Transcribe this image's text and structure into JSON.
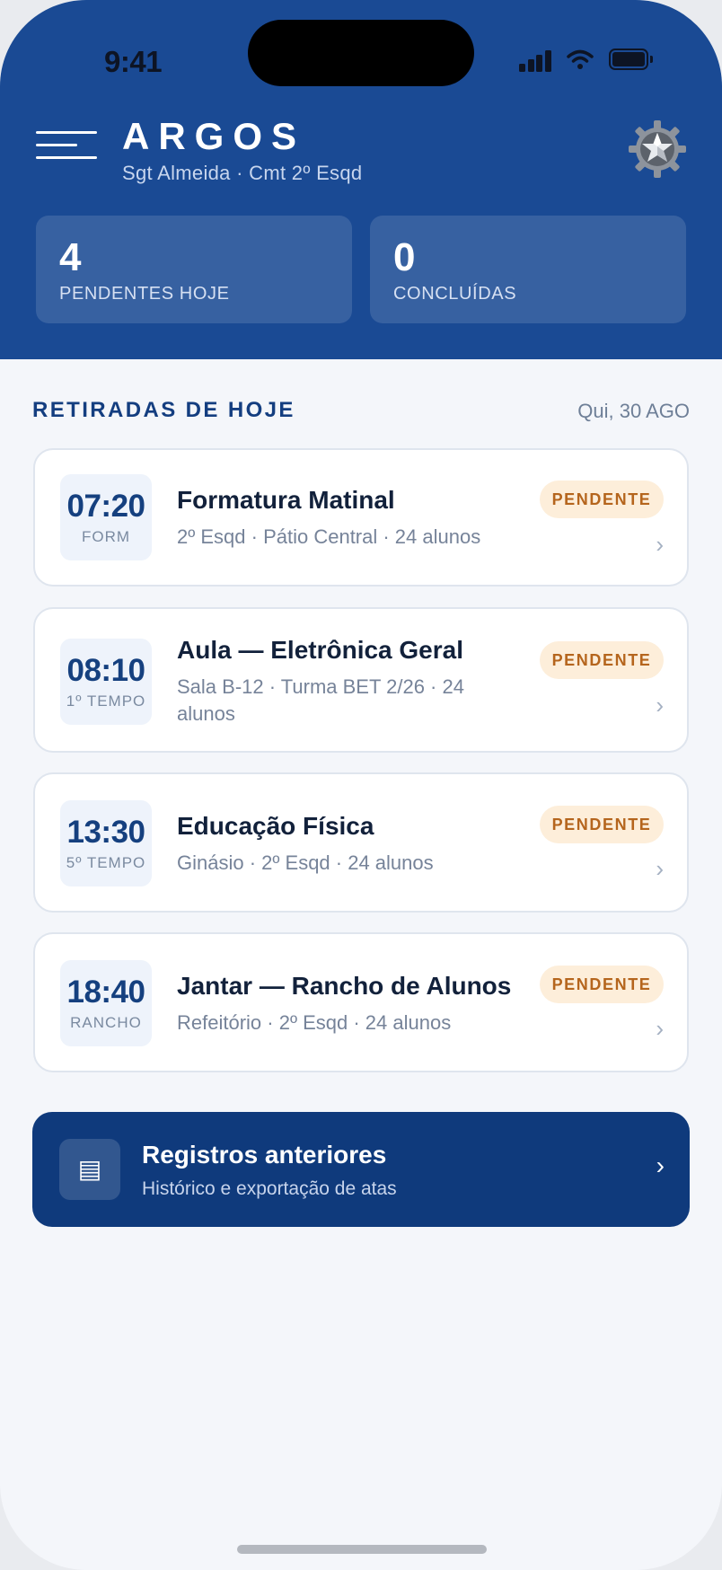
{
  "status_bar": {
    "time": "9:41"
  },
  "header": {
    "title": "ARGOS",
    "subtitle": "Sgt Almeida · Cmt 2º Esqd",
    "menu_icon": "hamburger-icon",
    "settings_icon": "gear-star-icon"
  },
  "stats": [
    {
      "value": "4",
      "label": "PENDENTES HOJE"
    },
    {
      "value": "0",
      "label": "CONCLUÍDAS"
    }
  ],
  "section": {
    "title": "RETIRADAS DE HOJE",
    "date": "Qui, 30 AGO"
  },
  "items": [
    {
      "time": "07:20",
      "period": "FORM",
      "title": "Formatura Matinal",
      "meta": "2º Esqd · Pátio Central · 24 alunos",
      "status": "PENDENTE"
    },
    {
      "time": "08:10",
      "period": "1º TEMPO",
      "title": "Aula — Eletrônica Geral",
      "meta": "Sala B-12 · Turma BET 2/26 · 24 alunos",
      "status": "PENDENTE"
    },
    {
      "time": "13:30",
      "period": "5º TEMPO",
      "title": "Educação Física",
      "meta": "Ginásio · 2º Esqd · 24 alunos",
      "status": "PENDENTE"
    },
    {
      "time": "18:40",
      "period": "RANCHO",
      "title": "Jantar — Rancho de Alunos",
      "meta": "Refeitório · 2º Esqd · 24 alunos",
      "status": "PENDENTE"
    }
  ],
  "history": {
    "icon": "document-list-icon",
    "title": "Registros anteriores",
    "subtitle": "Histórico e exportação de atas"
  },
  "colors": {
    "header": "#1a4a94",
    "accent": "#0f3a7c",
    "badge_bg": "#fdeeda",
    "badge_text": "#b5651d"
  }
}
